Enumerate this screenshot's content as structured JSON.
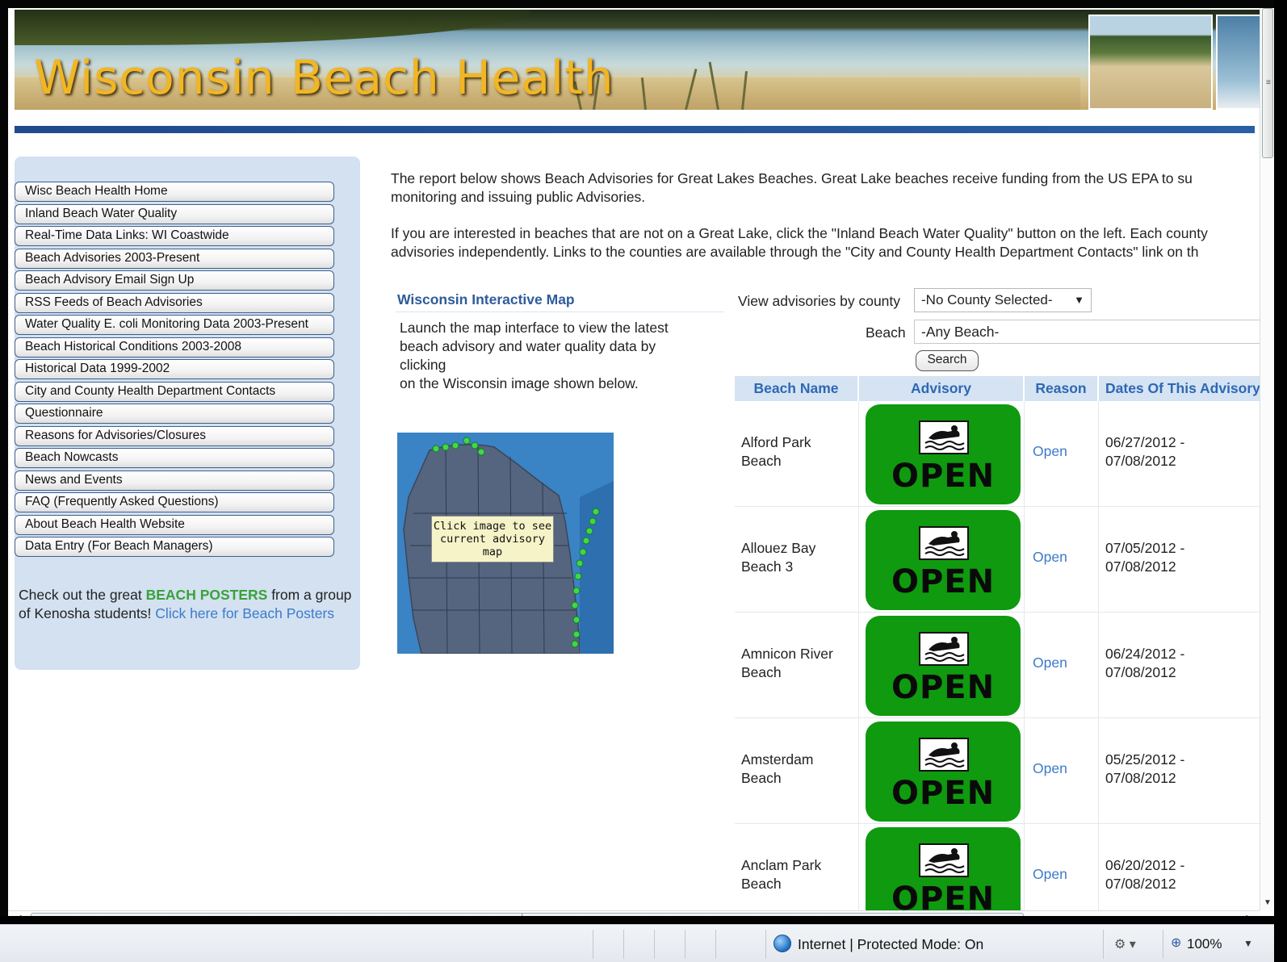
{
  "banner": {
    "title": "Wisconsin Beach Health"
  },
  "nav": [
    "Wisc Beach Health Home",
    "Inland Beach Water Quality",
    "Real-Time Data Links: WI Coastwide",
    "Beach Advisories 2003-Present",
    "Beach Advisory Email Sign Up",
    "RSS Feeds of Beach Advisories",
    "Water Quality E. coli Monitoring Data 2003-Present",
    "Beach Historical Conditions 2003-2008",
    "Historical Data 1999-2002",
    "City and County Health Department Contacts",
    "Questionnaire",
    "Reasons for Advisories/Closures",
    "Beach Nowcasts",
    "News and Events",
    "FAQ (Frequently Asked Questions)",
    "About Beach Health Website",
    "Data Entry (For Beach Managers)"
  ],
  "promo": {
    "prefix": "Check out the great ",
    "posters": "BEACH POSTERS",
    "middle": " from a group of Kenosha students! ",
    "link": "Click here for Beach Posters"
  },
  "intro": {
    "p1_line1": "The report below shows Beach Advisories for Great Lakes Beaches. Great Lake beaches receive funding from the US EPA to su",
    "p1_line2": "monitoring and issuing public Advisories.",
    "p2_line1": "If you are interested in beaches that are not on a Great Lake, click the \"Inland Beach Water Quality\" button on the left. Each county",
    "p2_line2": "advisories independently. Links to the counties are available through the \"City and County Health Department Contacts\" link on th"
  },
  "map": {
    "title": "Wisconsin Interactive Map",
    "desc_line1": "Launch the map interface to view the latest",
    "desc_line2": "beach advisory and water quality data by",
    "desc_line3": "clicking",
    "desc_line4": "on the Wisconsin image shown below.",
    "tip_line1": "Click image to see",
    "tip_line2": "current advisory",
    "tip_line3": "map"
  },
  "filters": {
    "county_label": "View advisories by county",
    "county_value": "-No County Selected-",
    "beach_label": "Beach",
    "beach_value": "-Any Beach-",
    "search_label": "Search"
  },
  "table": {
    "headers": [
      "Beach Name",
      "Advisory",
      "Reason",
      "Dates Of This Advisory"
    ],
    "rows": [
      {
        "name_line1": "Alford Park",
        "name_line2": "Beach",
        "advisory": "OPEN",
        "reason": "Open",
        "date_from": "06/27/2012 -",
        "date_to": "07/08/2012"
      },
      {
        "name_line1": "Allouez Bay",
        "name_line2": "Beach 3",
        "advisory": "OPEN",
        "reason": "Open",
        "date_from": "07/05/2012 -",
        "date_to": "07/08/2012"
      },
      {
        "name_line1": "Amnicon River",
        "name_line2": "Beach",
        "advisory": "OPEN",
        "reason": "Open",
        "date_from": "06/24/2012 -",
        "date_to": "07/08/2012"
      },
      {
        "name_line1": "Amsterdam",
        "name_line2": "Beach",
        "advisory": "OPEN",
        "reason": "Open",
        "date_from": "05/25/2012 -",
        "date_to": "07/08/2012"
      },
      {
        "name_line1": "Anclam Park",
        "name_line2": "Beach",
        "advisory": "OPEN",
        "reason": "Open",
        "date_from": "06/20/2012 -",
        "date_to": "07/08/2012"
      }
    ]
  },
  "status": {
    "zone": "Internet | Protected Mode: On",
    "zoom": "100%"
  },
  "colors": {
    "accent_blue": "#2e5b9a",
    "open_green": "#0f9a0f",
    "poster_green": "#3aa23a",
    "link_blue": "#3d7bc9"
  }
}
